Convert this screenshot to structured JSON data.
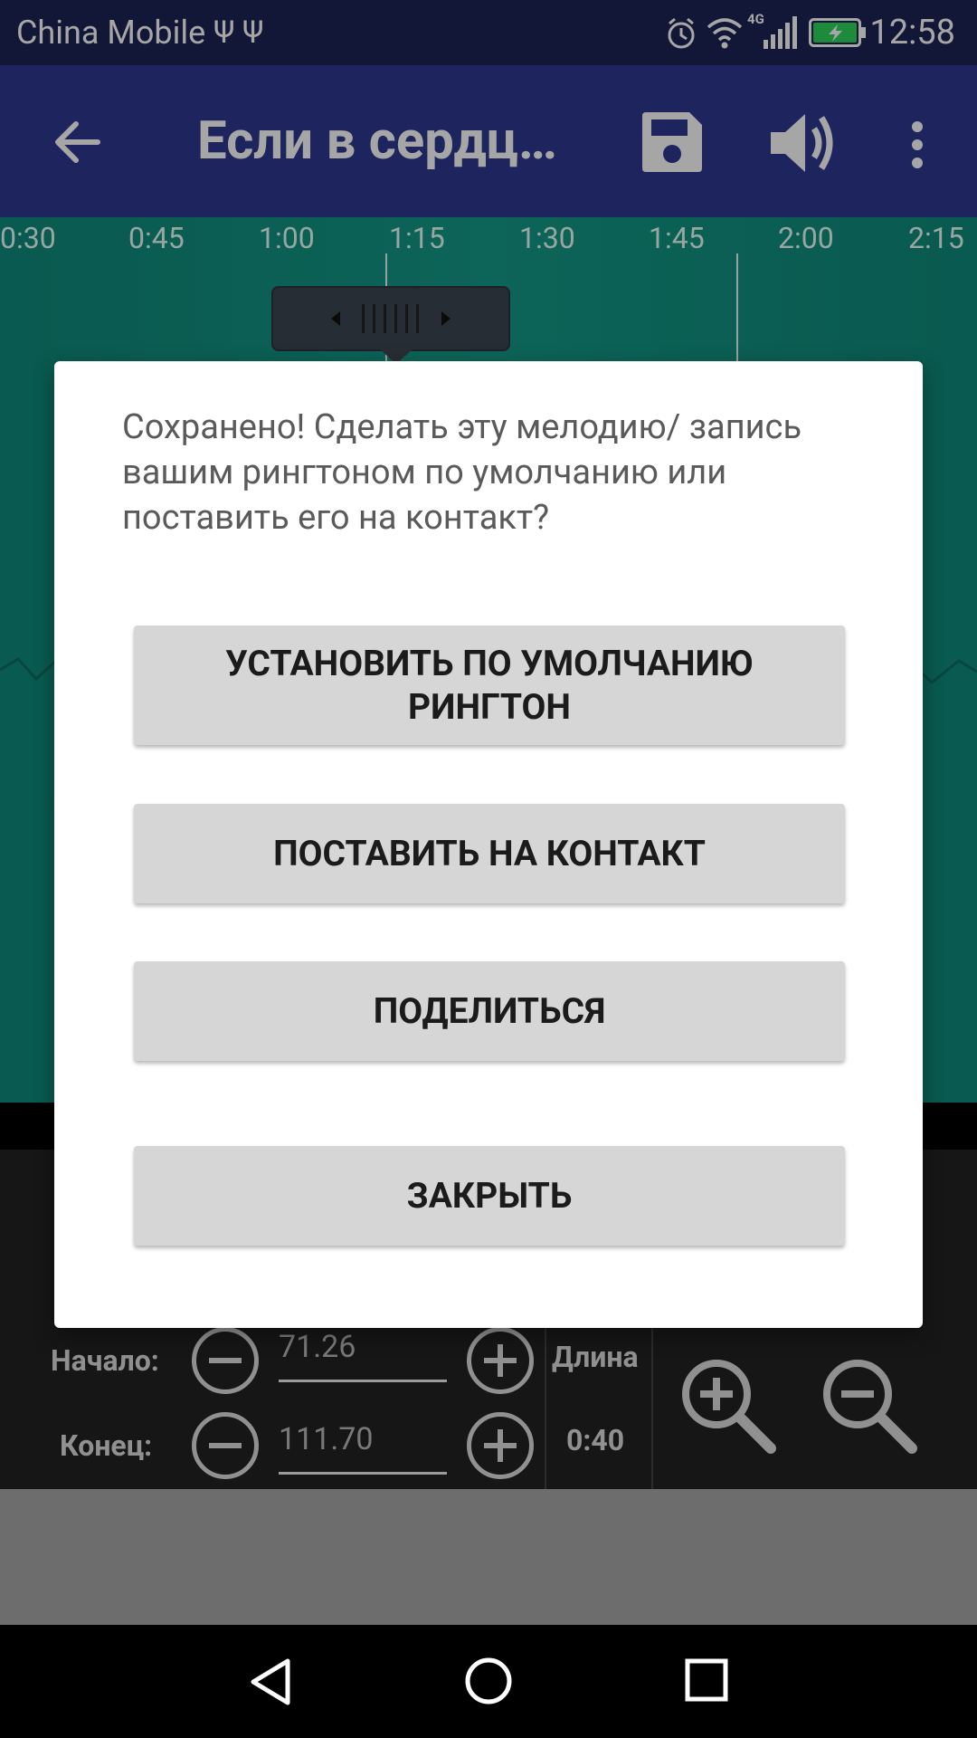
{
  "status_bar": {
    "carrier": "China Mobile",
    "usb_glyphs": "Ψ Ψ",
    "network": "4G",
    "time": "12:58"
  },
  "toolbar": {
    "title": "Если в сердц…",
    "icons": [
      "back-arrow-icon",
      "save-icon",
      "volume-icon",
      "more-vert-icon"
    ]
  },
  "timeline": {
    "ticks": [
      "0:30",
      "0:45",
      "1:00",
      "1:15",
      "1:30",
      "1:45",
      "2:00",
      "2:15"
    ]
  },
  "controls": {
    "start_label": "Начало:",
    "start_value": "71.26",
    "end_label": "Конец:",
    "end_value": "111.70",
    "length_label": "Длина",
    "length_value": "0:40"
  },
  "dialog": {
    "message": "Сохранено! Сделать эту мелодию/ запись вашим рингтоном по умолчанию или поставить его на контакт?",
    "buttons": {
      "set_default": "УСТАНОВИТЬ ПО УМОЛЧАНИЮ РИНГТОН",
      "set_contact": "ПОСТАВИТЬ НА КОНТАКТ",
      "share": "ПОДЕЛИТЬСЯ",
      "close": "ЗАКРЫТЬ"
    }
  },
  "colors": {
    "status_bar": "#1d2255",
    "toolbar": "#2f3a91",
    "waveform": "#129584",
    "dialog_button": "#d6d6d6"
  }
}
